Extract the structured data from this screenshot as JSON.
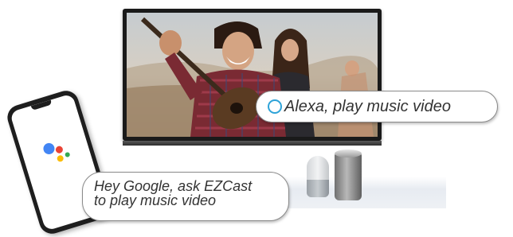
{
  "alexa_bubble": {
    "text": "Alexa, play music video",
    "icon": "alexa-ring-icon",
    "icon_color": "#2ea3d8"
  },
  "google_bubble": {
    "line1": "Hey Google, ask EZCast",
    "line2": "to play music video"
  },
  "google_assistant_colors": [
    "#4285f4",
    "#ea4335",
    "#fbbc05",
    "#34a853"
  ],
  "image_subject": "couple with guitar on tv screen"
}
